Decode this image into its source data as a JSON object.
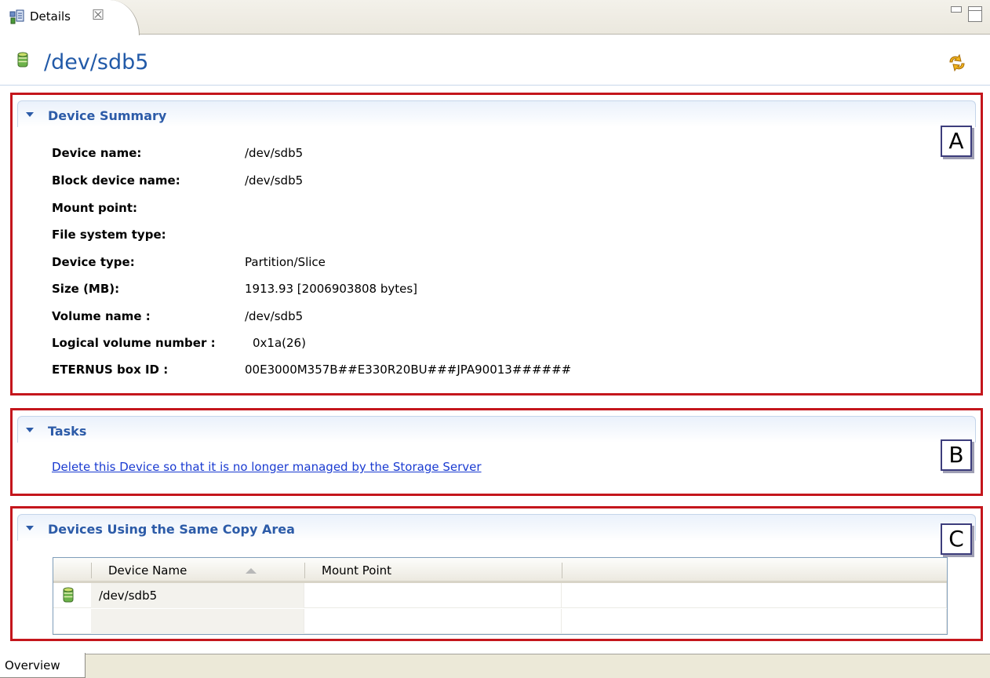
{
  "editor_tab": {
    "label": "Details",
    "icon": "details-icon",
    "close_symbol": "☒"
  },
  "header": {
    "title": "/dev/sdb5",
    "icon": "database-icon",
    "refresh_icon": "refresh-icon"
  },
  "annotations": {
    "a": "A",
    "b": "B",
    "c": "C"
  },
  "sections": {
    "summary": {
      "title": "Device Summary",
      "rows": [
        {
          "key": "Device name:",
          "value": "/dev/sdb5"
        },
        {
          "key": "Block device name:",
          "value": "/dev/sdb5"
        },
        {
          "key": "Mount point:",
          "value": ""
        },
        {
          "key": "File system type:",
          "value": ""
        },
        {
          "key": "Device type:",
          "value": "Partition/Slice"
        },
        {
          "key": "Size (MB):",
          "value": "1913.93 [2006903808 bytes]"
        },
        {
          "key": "Volume name :",
          "value": "/dev/sdb5"
        },
        {
          "key": "Logical volume number :",
          "value": "0x1a(26)"
        },
        {
          "key": "ETERNUS box ID :",
          "value": "00E3000M357B##E330R20BU###JPA90013######"
        }
      ]
    },
    "tasks": {
      "title": "Tasks",
      "link": "Delete this Device so that it is no longer managed by the Storage Server"
    },
    "copy_area": {
      "title": "Devices Using the Same Copy Area",
      "columns": [
        "Device Name",
        "Mount Point"
      ],
      "rows": [
        {
          "device_name": "/dev/sdb5",
          "mount_point": ""
        }
      ]
    }
  },
  "bottom_tabs": [
    "Overview"
  ],
  "colors": {
    "title_blue": "#225aa8",
    "section_blue": "#2c5ba8",
    "link_blue": "#1a3bd1",
    "annotation_red": "#c4161c"
  }
}
